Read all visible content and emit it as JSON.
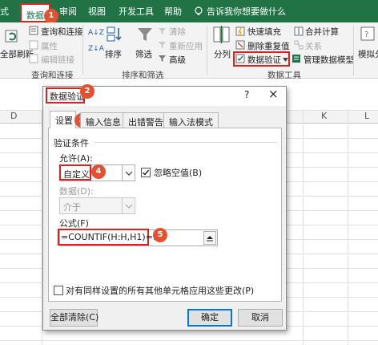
{
  "ribbon": {
    "tabs": {
      "partial_left": "式",
      "data": "数据",
      "review": "审阅",
      "view": "视图",
      "developer": "开发工具",
      "help": "帮助",
      "tell_me": "告诉我你想要做什么"
    },
    "get_data": {
      "refresh_all_partial": "全部刷新",
      "queries_connections": "查询和连接",
      "properties": "属性",
      "edit_links": "编辑链接",
      "group_label": "查询和连接"
    },
    "sort_filter": {
      "sort_az": "A↓Z",
      "sort_za": "Z↓A",
      "sort": "排序",
      "filter": "筛选",
      "clear": "清除",
      "reapply": "重新应用",
      "advanced": "高级",
      "group_label": "排序和筛选"
    },
    "data_tools": {
      "text_to_columns": "分列",
      "flash_fill": "快速填充",
      "remove_duplicates": "删除重复值",
      "data_validation": "数据验证",
      "consolidate": "合并计算",
      "relationships": "关系",
      "manage_data_model": "管理数据模型",
      "group_label": "数据工具"
    },
    "forecast": {
      "what_if_partial": "模拟分"
    }
  },
  "sheet": {
    "col_headers": {
      "d": "D",
      "k": "K",
      "l": "L"
    }
  },
  "dialog": {
    "title": "数据验证",
    "help": "?",
    "close": "×",
    "tabs": {
      "settings": "设置",
      "input_message": "输入信息",
      "error_alert": "出错警告",
      "ime_mode": "输入法模式"
    },
    "criteria_label": "验证条件",
    "allow_label": "允许(A):",
    "allow_value": "自定义",
    "ignore_blank": "忽略空值(B)",
    "data_label": "数据(D):",
    "data_value": "介于",
    "formula_label": "公式(F)",
    "formula_value": "=COUNTIF(H:H,H1)=1",
    "apply_all": "对有同样设置的所有其他单元格应用这些更改(P)",
    "clear_all": "全部清除(C)",
    "ok": "确定",
    "cancel": "取消"
  },
  "annotations": {
    "b1": "1",
    "b2": "2",
    "b3": "3",
    "b4": "4",
    "b5": "5"
  },
  "colors": {
    "excel_green": "#217346",
    "highlight_red": "#e02020",
    "badge_orange": "#e7502e"
  }
}
